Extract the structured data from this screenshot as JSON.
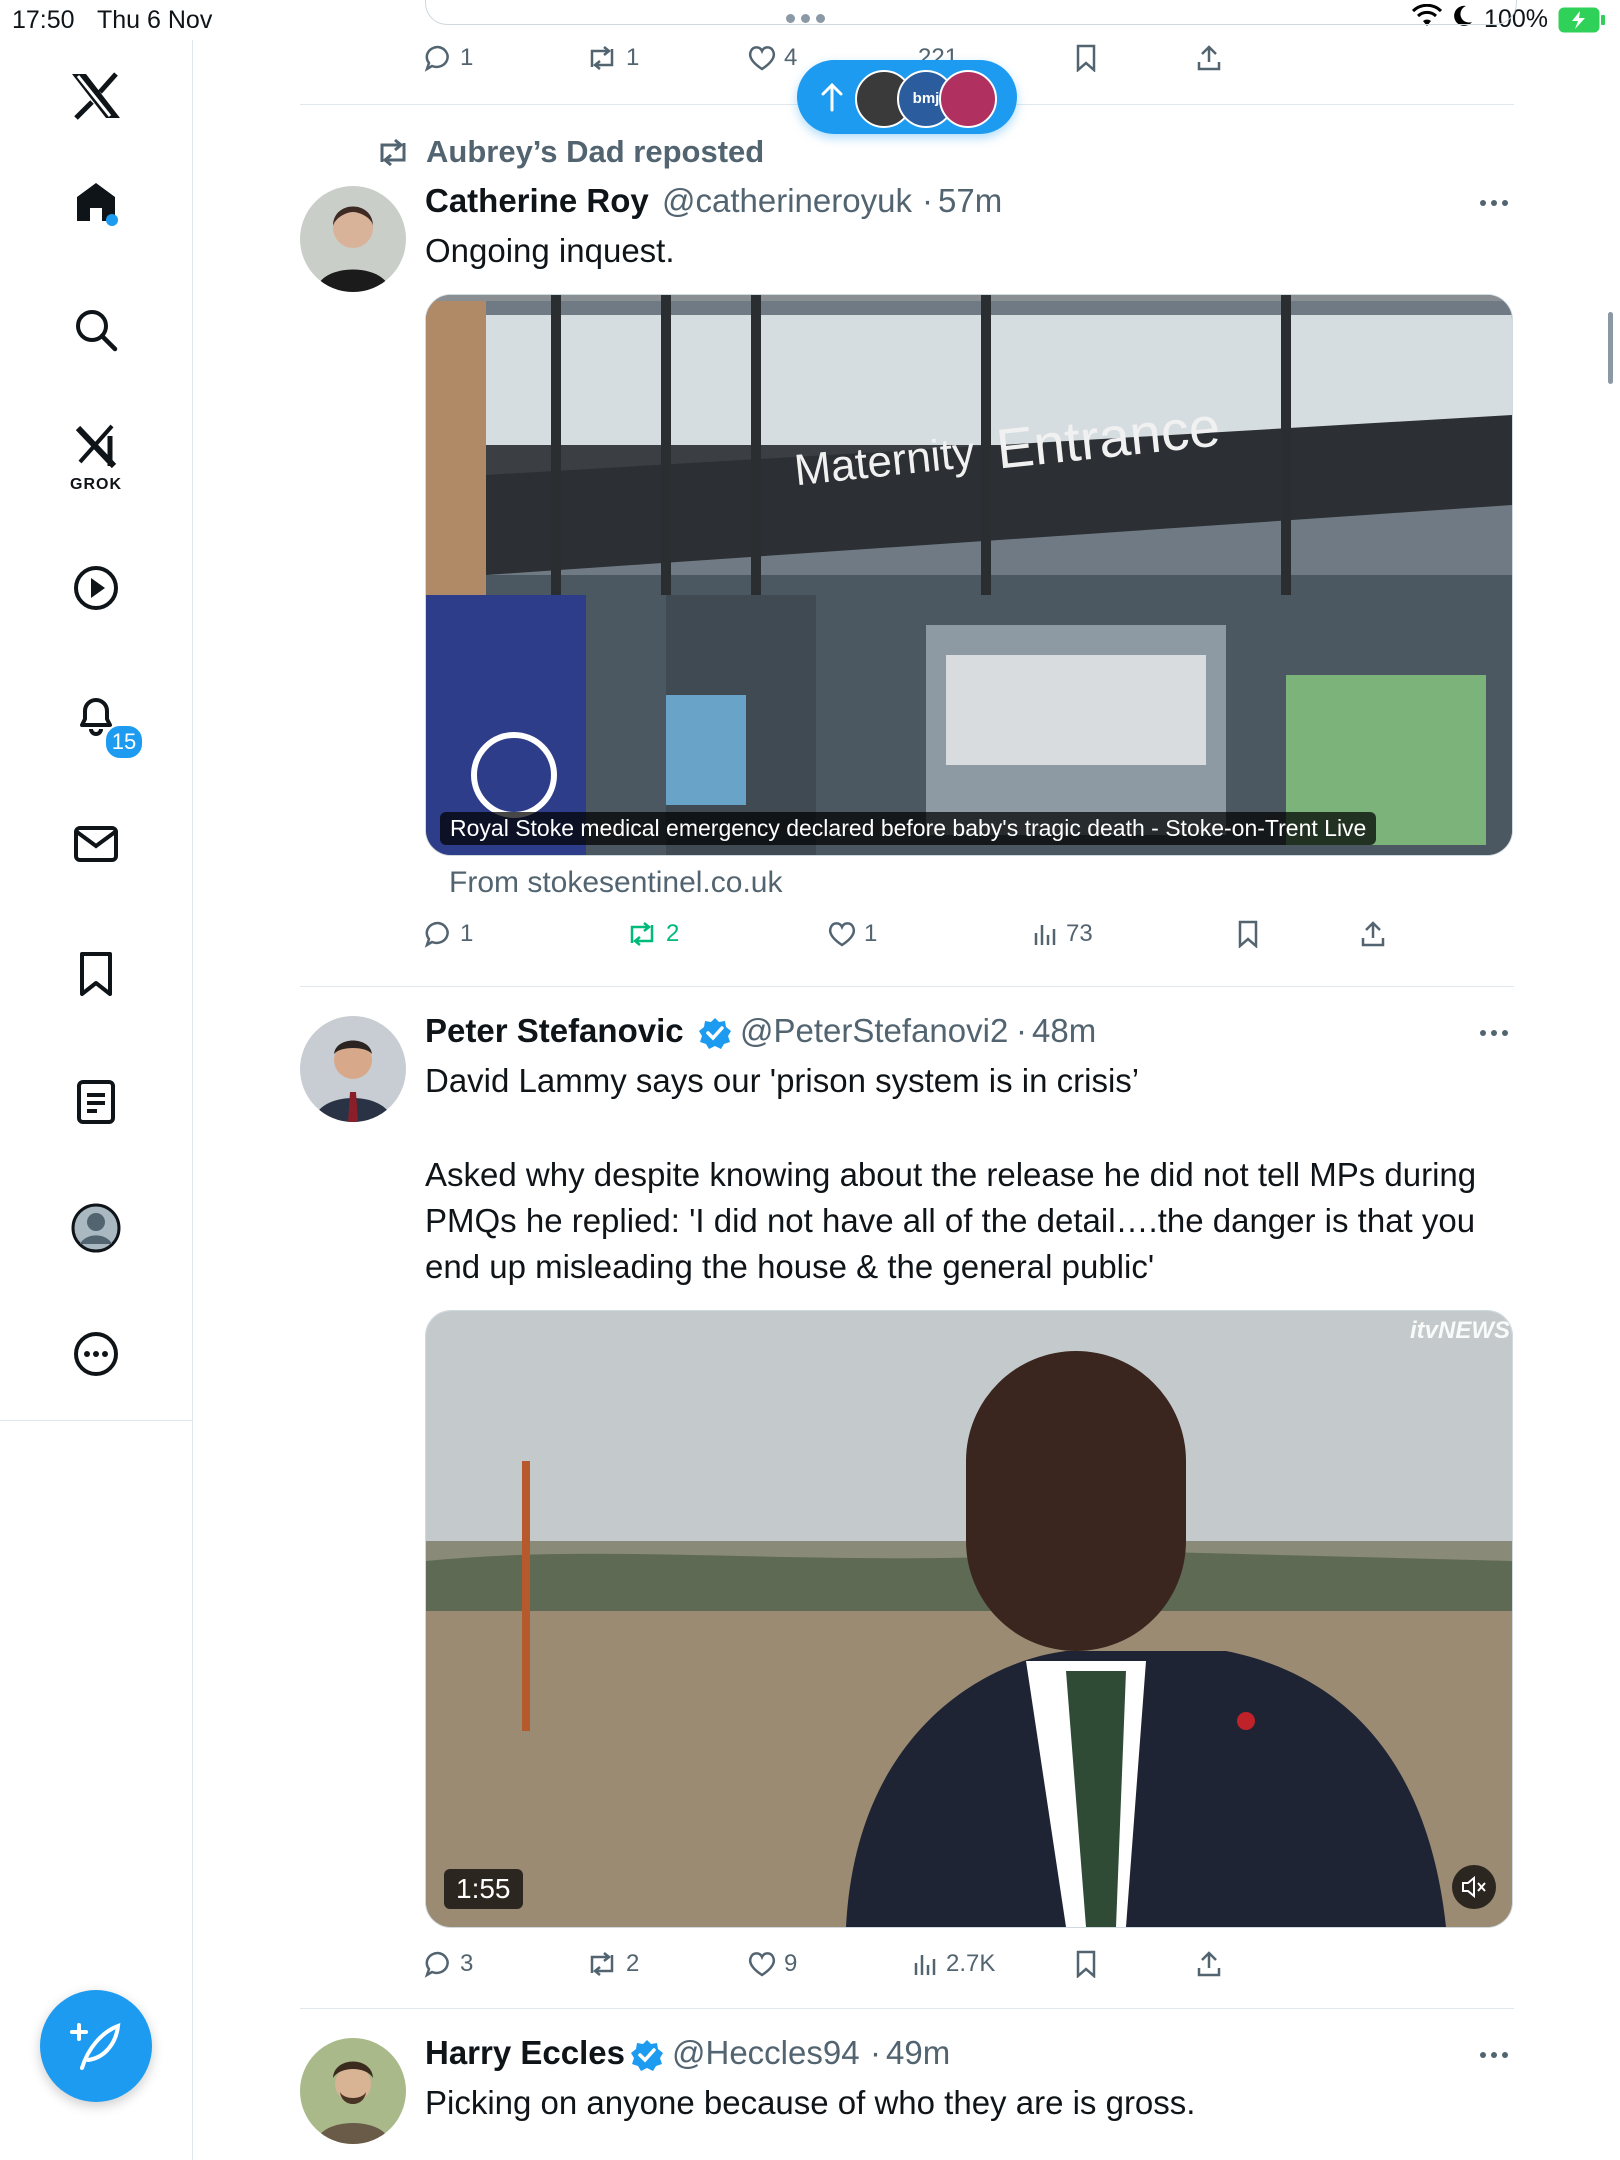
{
  "status_bar": {
    "time": "17:50",
    "date": "Thu 6 Nov",
    "battery": "100%"
  },
  "sidebar": {
    "items": [
      {
        "name": "x-logo-icon"
      },
      {
        "name": "home-icon"
      },
      {
        "name": "search-icon"
      },
      {
        "name": "grok-icon",
        "label": "GROK"
      },
      {
        "name": "video-icon"
      },
      {
        "name": "notifications-icon",
        "badge": "15"
      },
      {
        "name": "messages-icon"
      },
      {
        "name": "bookmarks-icon"
      },
      {
        "name": "lists-icon"
      },
      {
        "name": "profile-icon"
      },
      {
        "name": "more-icon"
      }
    ],
    "compose": {
      "name": "compose-icon"
    }
  },
  "top_actions": {
    "replies": "1",
    "reposts": "1",
    "likes": "4",
    "views": "221"
  },
  "pill": {
    "avatar_text": "bmj"
  },
  "posts": [
    {
      "repost_label": "Aubrey’s Dad reposted",
      "name": "Catherine Roy",
      "handle": "@catherineroyuk",
      "separator": "·",
      "time": "57m",
      "text": "Ongoing inquest.",
      "card": {
        "image_text_1": "Maternity",
        "image_text_2": "Entrance",
        "caption": "Royal Stoke medical emergency declared before baby's tragic death - Stoke-on-Trent Live",
        "from": "From stokesentinel.co.uk"
      },
      "actions": {
        "replies": "1",
        "reposts": "2",
        "likes": "1",
        "views": "73"
      }
    },
    {
      "name": "Peter Stefanovic",
      "handle": "@PeterStefanovi2",
      "separator": "·",
      "time": "48m",
      "text_1": "David Lammy says our 'prison system is in crisis’",
      "text_2": "Asked why despite knowing about the release he did not tell MPs during PMQs he replied: 'I did not have all of the detail….the danger is that you end up misleading the house & the general public'",
      "video": {
        "duration": "1:55",
        "watermark": "itvNEWS"
      },
      "actions": {
        "replies": "3",
        "reposts": "2",
        "likes": "9",
        "views": "2.7K"
      }
    },
    {
      "name": "Harry Eccles",
      "handle": "@Heccles94",
      "separator": "·",
      "time": "49m",
      "text": "Picking on anyone because of who they are is gross."
    }
  ],
  "colors": {
    "accent": "#1d9bf0",
    "repost_green": "#00ba7c",
    "text": "#0f1419",
    "muted": "#536471"
  }
}
